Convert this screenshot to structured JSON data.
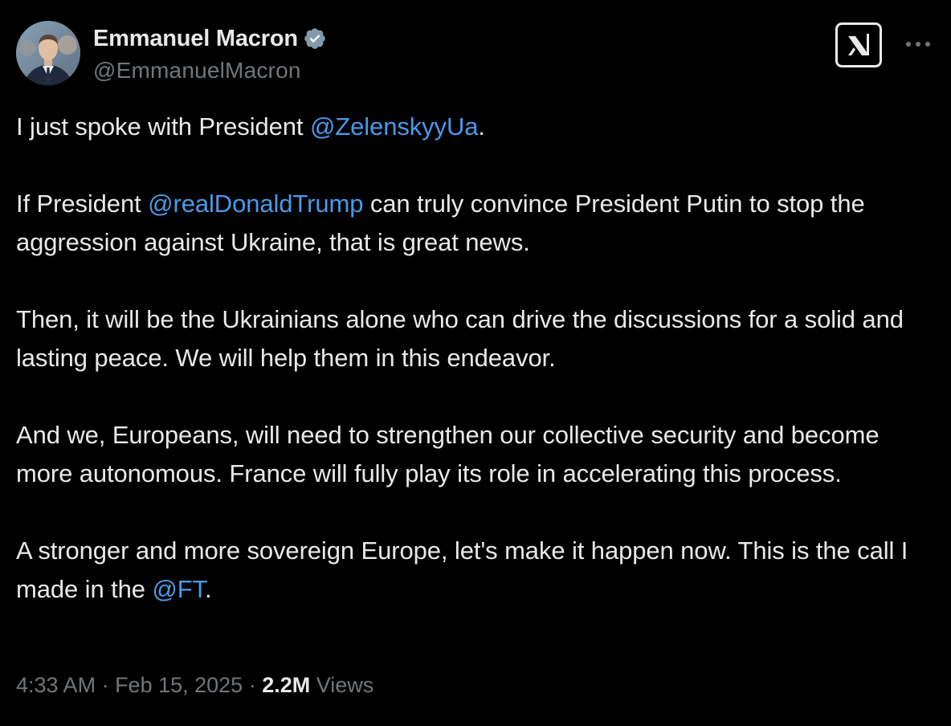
{
  "author": {
    "display_name": "Emmanuel Macron",
    "handle": "@EmmanuelMacron",
    "verified": true,
    "verified_badge_color": "#829aab"
  },
  "actions": {
    "grok_icon": "grok-icon",
    "more_icon": "more-horizontal-icon"
  },
  "tweet": {
    "p1": {
      "before": "I just spoke with President ",
      "mention": "@ZelenskyyUa",
      "after": "."
    },
    "p2": {
      "before": "If President ",
      "mention": "@realDonaldTrump",
      "after": " can truly convince President Putin to stop the aggression against Ukraine, that is great news."
    },
    "p3": {
      "text": "Then, it will be the Ukrainians alone who can drive the discussions for a solid and lasting peace. We will help them in this endeavor."
    },
    "p4": {
      "text": "And we, Europeans, will need to strengthen our collective security and become more autonomous. France will fully play its role in accelerating this process."
    },
    "p5": {
      "before": "A stronger and more sovereign Europe, let's make it happen now. This is the call I made in the ",
      "mention": "@FT",
      "after": "."
    }
  },
  "meta": {
    "time": "4:33 AM",
    "separator": " · ",
    "date": "Feb 15, 2025",
    "views_count": "2.2M",
    "views_label": " Views"
  },
  "colors": {
    "background": "#000000",
    "text": "#e7e9ea",
    "secondary": "#71767b",
    "link": "#4a99e9"
  }
}
